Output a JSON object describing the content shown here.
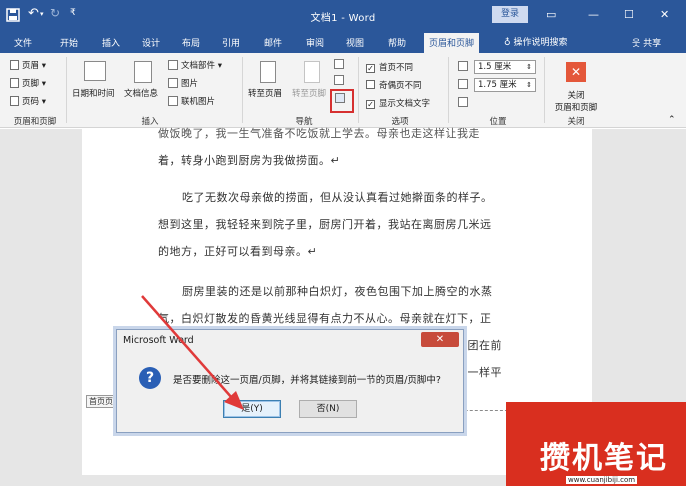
{
  "window": {
    "title": "文档1  -  Word",
    "login_label": "登录",
    "colors": {
      "titlebar": "#2b579a",
      "ribbon": "#f3f3f3",
      "highlight": "#d63030"
    }
  },
  "tabs": [
    {
      "label": "文件"
    },
    {
      "label": "开始"
    },
    {
      "label": "插入"
    },
    {
      "label": "设计"
    },
    {
      "label": "布局"
    },
    {
      "label": "引用"
    },
    {
      "label": "邮件"
    },
    {
      "label": "审阅"
    },
    {
      "label": "视图"
    },
    {
      "label": "帮助"
    },
    {
      "label": "页眉和页脚",
      "active": true
    }
  ],
  "tell_me": "操作说明搜索",
  "share": "共享",
  "ribbon": {
    "header_footer": {
      "header": "页眉 ▾",
      "footer": "页脚 ▾",
      "page_number": "页码 ▾",
      "group": "页眉和页脚"
    },
    "insert": {
      "date_time": "日期和时间",
      "doc_info": "文档信息",
      "doc_parts": "文档部件 ▾",
      "picture": "图片",
      "online_picture": "联机图片",
      "group": "插入"
    },
    "navigation": {
      "goto_header": "转至页眉",
      "goto_footer": "转至页脚",
      "group": "导航"
    },
    "options": {
      "different_first": "首页不同",
      "different_odd_even": "奇偶页不同",
      "show_doc_text": "显示文档文字",
      "group": "选项"
    },
    "position": {
      "header_from_top": "1.5 厘米",
      "footer_from_bottom": "1.75 厘米",
      "group": "位置"
    },
    "close": {
      "label1": "关闭",
      "label2": "页眉和页脚",
      "group": "关闭"
    }
  },
  "document": {
    "lines": [
      "做饭晚了，我一生气准备不吃饭就上学去。母亲也走这样让我走",
      "着，转身小跑到厨房为我做捞面。↵",
      "吃了无数次母亲做的捞面，但从没认真看过她擀面条的样子。",
      "想到这里，我轻轻来到院子里，厨房门开着，我站在离厨房几米远",
      "的地方，正好可以看到母亲。↵",
      "厨房里装的还是以前那种白炽灯，夜色包围下加上腾空的水蒸",
      "气，白炽灯散发的昏黄光线显得有点力不从心。母亲就在灯下，正",
      "面团在前",
      "纸一样平"
    ],
    "first_page_tag": "首页页"
  },
  "dialog": {
    "title": "Microsoft Word",
    "message": "是否要删除这一页眉/页脚，并将其链接到前一节的页眉/页脚中?",
    "yes": "是(Y)",
    "no": "否(N)"
  },
  "watermark": {
    "text": "攒机笔记",
    "url": "www.cuanjibiji.com"
  }
}
